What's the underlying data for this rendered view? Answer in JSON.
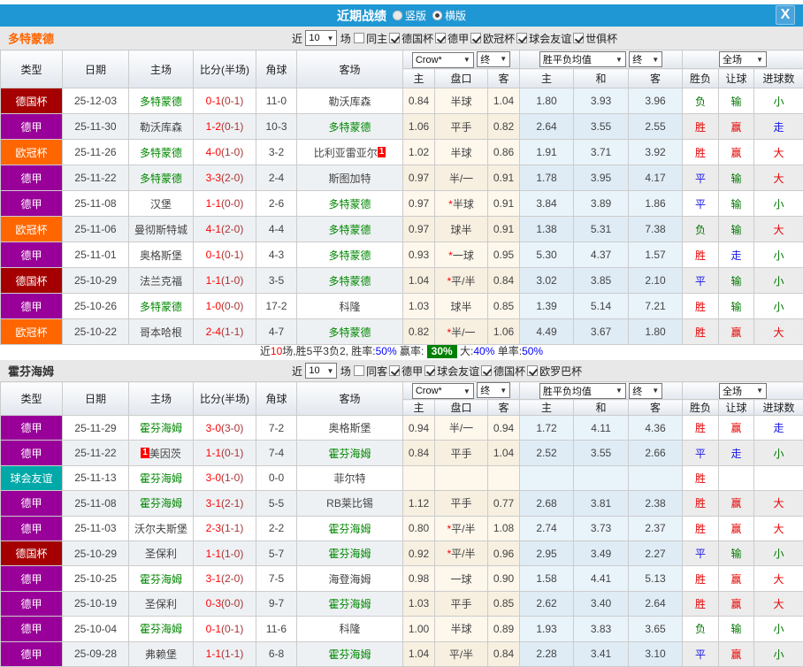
{
  "title_bar": {
    "title": "近期战绩",
    "vertical": "竖版",
    "horizontal": "横版",
    "close": "X"
  },
  "league_colors": {
    "德国杯": "#a50000",
    "德甲": "#990099",
    "欧冠杯": "#ff6600",
    "球会友谊": "#00a8a8"
  },
  "result_colors": {
    "胜": "#e60000",
    "平": "#1414e6",
    "负": "#007700",
    "赢": "#e60000",
    "输": "#007700",
    "走": "#1414e6",
    "大": "#e60000",
    "小": "#007700"
  },
  "columns": {
    "main": [
      "类型",
      "日期",
      "主场",
      "比分(半场)",
      "角球",
      "客场"
    ],
    "sub": [
      "主",
      "盘口",
      "客",
      "主",
      "和",
      "客",
      "胜负",
      "让球",
      "进球数"
    ],
    "crow_select": "Crow*",
    "final_select": "终",
    "avg_select": "胜平负均值",
    "scope_select": "全场"
  },
  "sections": [
    {
      "team": "多特蒙德",
      "team_color": "#ff6600",
      "filter": {
        "near": "近",
        "count": "10",
        "games": "场",
        "same": "同主",
        "same_checked": false,
        "leagues": [
          "德国杯",
          "德甲",
          "欧冠杯",
          "球会友谊",
          "世俱杯"
        ]
      },
      "rows": [
        {
          "league": "德国杯",
          "date": "25-12-03",
          "home": "多特蒙德",
          "home_hl": true,
          "home_sup": "",
          "score": "0-1",
          "half": "(0-1)",
          "corners": "11-0",
          "away": "勒沃库森",
          "away_hl": false,
          "away_sup": "",
          "crow_home": "0.84",
          "handicap": "半球",
          "crow_away": "1.04",
          "avg_home": "1.80",
          "avg_draw": "3.93",
          "avg_away": "3.96",
          "result": "负",
          "handicap_result": "输",
          "goals": "小"
        },
        {
          "league": "德甲",
          "date": "25-11-30",
          "home": "勒沃库森",
          "home_hl": false,
          "home_sup": "",
          "score": "1-2",
          "half": "(0-1)",
          "corners": "10-3",
          "away": "多特蒙德",
          "away_hl": true,
          "away_sup": "",
          "crow_home": "1.06",
          "handicap": "平手",
          "crow_away": "0.82",
          "avg_home": "2.64",
          "avg_draw": "3.55",
          "avg_away": "2.55",
          "result": "胜",
          "handicap_result": "赢",
          "goals": "走"
        },
        {
          "league": "欧冠杯",
          "date": "25-11-26",
          "home": "多特蒙德",
          "home_hl": true,
          "home_sup": "",
          "score": "4-0",
          "half": "(1-0)",
          "corners": "3-2",
          "away": "比利亚雷亚尔",
          "away_hl": false,
          "away_sup": "1",
          "crow_home": "1.02",
          "handicap": "半球",
          "crow_away": "0.86",
          "avg_home": "1.91",
          "avg_draw": "3.71",
          "avg_away": "3.92",
          "result": "胜",
          "handicap_result": "赢",
          "goals": "大"
        },
        {
          "league": "德甲",
          "date": "25-11-22",
          "home": "多特蒙德",
          "home_hl": true,
          "home_sup": "",
          "score": "3-3",
          "half": "(2-0)",
          "corners": "2-4",
          "away": "斯图加特",
          "away_hl": false,
          "away_sup": "",
          "crow_home": "0.97",
          "handicap": "半/一",
          "crow_away": "0.91",
          "avg_home": "1.78",
          "avg_draw": "3.95",
          "avg_away": "4.17",
          "result": "平",
          "handicap_result": "输",
          "goals": "大"
        },
        {
          "league": "德甲",
          "date": "25-11-08",
          "home": "汉堡",
          "home_hl": false,
          "home_sup": "",
          "score": "1-1",
          "half": "(0-0)",
          "corners": "2-6",
          "away": "多特蒙德",
          "away_hl": true,
          "away_sup": "",
          "crow_home": "0.97",
          "handicap": "*半球",
          "crow_away": "0.91",
          "avg_home": "3.84",
          "avg_draw": "3.89",
          "avg_away": "1.86",
          "result": "平",
          "handicap_result": "输",
          "goals": "小"
        },
        {
          "league": "欧冠杯",
          "date": "25-11-06",
          "home": "曼彻斯特城",
          "home_hl": false,
          "home_sup": "",
          "score": "4-1",
          "half": "(2-0)",
          "corners": "4-4",
          "away": "多特蒙德",
          "away_hl": true,
          "away_sup": "",
          "crow_home": "0.97",
          "handicap": "球半",
          "crow_away": "0.91",
          "avg_home": "1.38",
          "avg_draw": "5.31",
          "avg_away": "7.38",
          "result": "负",
          "handicap_result": "输",
          "goals": "大"
        },
        {
          "league": "德甲",
          "date": "25-11-01",
          "home": "奥格斯堡",
          "home_hl": false,
          "home_sup": "",
          "score": "0-1",
          "half": "(0-1)",
          "corners": "4-3",
          "away": "多特蒙德",
          "away_hl": true,
          "away_sup": "",
          "crow_home": "0.93",
          "handicap": "*一球",
          "crow_away": "0.95",
          "avg_home": "5.30",
          "avg_draw": "4.37",
          "avg_away": "1.57",
          "result": "胜",
          "handicap_result": "走",
          "goals": "小"
        },
        {
          "league": "德国杯",
          "date": "25-10-29",
          "home": "法兰克福",
          "home_hl": false,
          "home_sup": "",
          "score": "1-1",
          "half": "(1-0)",
          "corners": "3-5",
          "away": "多特蒙德",
          "away_hl": true,
          "away_sup": "",
          "crow_home": "1.04",
          "handicap": "*平/半",
          "crow_away": "0.84",
          "avg_home": "3.02",
          "avg_draw": "3.85",
          "avg_away": "2.10",
          "result": "平",
          "handicap_result": "输",
          "goals": "小"
        },
        {
          "league": "德甲",
          "date": "25-10-26",
          "home": "多特蒙德",
          "home_hl": true,
          "home_sup": "",
          "score": "1-0",
          "half": "(0-0)",
          "corners": "17-2",
          "away": "科隆",
          "away_hl": false,
          "away_sup": "",
          "crow_home": "1.03",
          "handicap": "球半",
          "crow_away": "0.85",
          "avg_home": "1.39",
          "avg_draw": "5.14",
          "avg_away": "7.21",
          "result": "胜",
          "handicap_result": "输",
          "goals": "小"
        },
        {
          "league": "欧冠杯",
          "date": "25-10-22",
          "home": "哥本哈根",
          "home_hl": false,
          "home_sup": "",
          "score": "2-4",
          "half": "(1-1)",
          "corners": "4-7",
          "away": "多特蒙德",
          "away_hl": true,
          "away_sup": "",
          "crow_home": "0.82",
          "handicap": "*半/一",
          "crow_away": "1.06",
          "avg_home": "4.49",
          "avg_draw": "3.67",
          "avg_away": "1.80",
          "result": "胜",
          "handicap_result": "赢",
          "goals": "大"
        }
      ],
      "summary": [
        {
          "t": "近",
          "c": "#333333"
        },
        {
          "t": "10",
          "c": "#ff0000"
        },
        {
          "t": "场,胜5平3负2, 胜率:",
          "c": "#333333"
        },
        {
          "t": "50%",
          "c": "#0000ff"
        },
        {
          "t": " 赢率: ",
          "c": "#333333"
        },
        {
          "t": "30%",
          "c": "#ffffff",
          "bg": "#008000"
        },
        {
          "t": " 大:",
          "c": "#333333"
        },
        {
          "t": "40%",
          "c": "#0000ff"
        },
        {
          "t": " 单率:",
          "c": "#333333"
        },
        {
          "t": "50%",
          "c": "#0000ff"
        }
      ]
    },
    {
      "team": "霍芬海姆",
      "team_color": "#333333",
      "filter": {
        "near": "近",
        "count": "10",
        "games": "场",
        "same": "同客",
        "same_checked": false,
        "leagues": [
          "德甲",
          "球会友谊",
          "德国杯",
          "欧罗巴杯"
        ]
      },
      "rows": [
        {
          "league": "德甲",
          "date": "25-11-29",
          "home": "霍芬海姆",
          "home_hl": true,
          "home_sup": "",
          "score": "3-0",
          "half": "(3-0)",
          "corners": "7-2",
          "away": "奥格斯堡",
          "away_hl": false,
          "away_sup": "",
          "crow_home": "0.94",
          "handicap": "半/一",
          "crow_away": "0.94",
          "avg_home": "1.72",
          "avg_draw": "4.11",
          "avg_away": "4.36",
          "result": "胜",
          "handicap_result": "赢",
          "goals": "走"
        },
        {
          "league": "德甲",
          "date": "25-11-22",
          "home": "美因茨",
          "home_hl": false,
          "home_sup": "1",
          "score": "1-1",
          "half": "(0-1)",
          "corners": "7-4",
          "away": "霍芬海姆",
          "away_hl": true,
          "away_sup": "",
          "crow_home": "0.84",
          "handicap": "平手",
          "crow_away": "1.04",
          "avg_home": "2.52",
          "avg_draw": "3.55",
          "avg_away": "2.66",
          "result": "平",
          "handicap_result": "走",
          "goals": "小"
        },
        {
          "league": "球会友谊",
          "date": "25-11-13",
          "home": "霍芬海姆",
          "home_hl": true,
          "home_sup": "",
          "score": "3-0",
          "half": "(1-0)",
          "corners": "0-0",
          "away": "菲尔特",
          "away_hl": false,
          "away_sup": "",
          "crow_home": "",
          "handicap": "",
          "crow_away": "",
          "avg_home": "",
          "avg_draw": "",
          "avg_away": "",
          "result": "胜",
          "handicap_result": "",
          "goals": ""
        },
        {
          "league": "德甲",
          "date": "25-11-08",
          "home": "霍芬海姆",
          "home_hl": true,
          "home_sup": "",
          "score": "3-1",
          "half": "(2-1)",
          "corners": "5-5",
          "away": "RB莱比锡",
          "away_hl": false,
          "away_sup": "",
          "crow_home": "1.12",
          "handicap": "平手",
          "crow_away": "0.77",
          "avg_home": "2.68",
          "avg_draw": "3.81",
          "avg_away": "2.38",
          "result": "胜",
          "handicap_result": "赢",
          "goals": "大"
        },
        {
          "league": "德甲",
          "date": "25-11-03",
          "home": "沃尔夫斯堡",
          "home_hl": false,
          "home_sup": "",
          "score": "2-3",
          "half": "(1-1)",
          "corners": "2-2",
          "away": "霍芬海姆",
          "away_hl": true,
          "away_sup": "",
          "crow_home": "0.80",
          "handicap": "*平/半",
          "crow_away": "1.08",
          "avg_home": "2.74",
          "avg_draw": "3.73",
          "avg_away": "2.37",
          "result": "胜",
          "handicap_result": "赢",
          "goals": "大"
        },
        {
          "league": "德国杯",
          "date": "25-10-29",
          "home": "圣保利",
          "home_hl": false,
          "home_sup": "",
          "score": "1-1",
          "half": "(1-0)",
          "corners": "5-7",
          "away": "霍芬海姆",
          "away_hl": true,
          "away_sup": "",
          "crow_home": "0.92",
          "handicap": "*平/半",
          "crow_away": "0.96",
          "avg_home": "2.95",
          "avg_draw": "3.49",
          "avg_away": "2.27",
          "result": "平",
          "handicap_result": "输",
          "goals": "小"
        },
        {
          "league": "德甲",
          "date": "25-10-25",
          "home": "霍芬海姆",
          "home_hl": true,
          "home_sup": "",
          "score": "3-1",
          "half": "(2-0)",
          "corners": "7-5",
          "away": "海登海姆",
          "away_hl": false,
          "away_sup": "",
          "crow_home": "0.98",
          "handicap": "一球",
          "crow_away": "0.90",
          "avg_home": "1.58",
          "avg_draw": "4.41",
          "avg_away": "5.13",
          "result": "胜",
          "handicap_result": "赢",
          "goals": "大"
        },
        {
          "league": "德甲",
          "date": "25-10-19",
          "home": "圣保利",
          "home_hl": false,
          "home_sup": "",
          "score": "0-3",
          "half": "(0-0)",
          "corners": "9-7",
          "away": "霍芬海姆",
          "away_hl": true,
          "away_sup": "",
          "crow_home": "1.03",
          "handicap": "平手",
          "crow_away": "0.85",
          "avg_home": "2.62",
          "avg_draw": "3.40",
          "avg_away": "2.64",
          "result": "胜",
          "handicap_result": "赢",
          "goals": "大"
        },
        {
          "league": "德甲",
          "date": "25-10-04",
          "home": "霍芬海姆",
          "home_hl": true,
          "home_sup": "",
          "score": "0-1",
          "half": "(0-1)",
          "corners": "11-6",
          "away": "科隆",
          "away_hl": false,
          "away_sup": "",
          "crow_home": "1.00",
          "handicap": "半球",
          "crow_away": "0.89",
          "avg_home": "1.93",
          "avg_draw": "3.83",
          "avg_away": "3.65",
          "result": "负",
          "handicap_result": "输",
          "goals": "小"
        },
        {
          "league": "德甲",
          "date": "25-09-28",
          "home": "弗赖堡",
          "home_hl": false,
          "home_sup": "",
          "score": "1-1",
          "half": "(1-1)",
          "corners": "6-8",
          "away": "霍芬海姆",
          "away_hl": true,
          "away_sup": "",
          "crow_home": "1.04",
          "handicap": "平/半",
          "crow_away": "0.84",
          "avg_home": "2.28",
          "avg_draw": "3.41",
          "avg_away": "3.10",
          "result": "平",
          "handicap_result": "赢",
          "goals": "小"
        }
      ]
    }
  ]
}
